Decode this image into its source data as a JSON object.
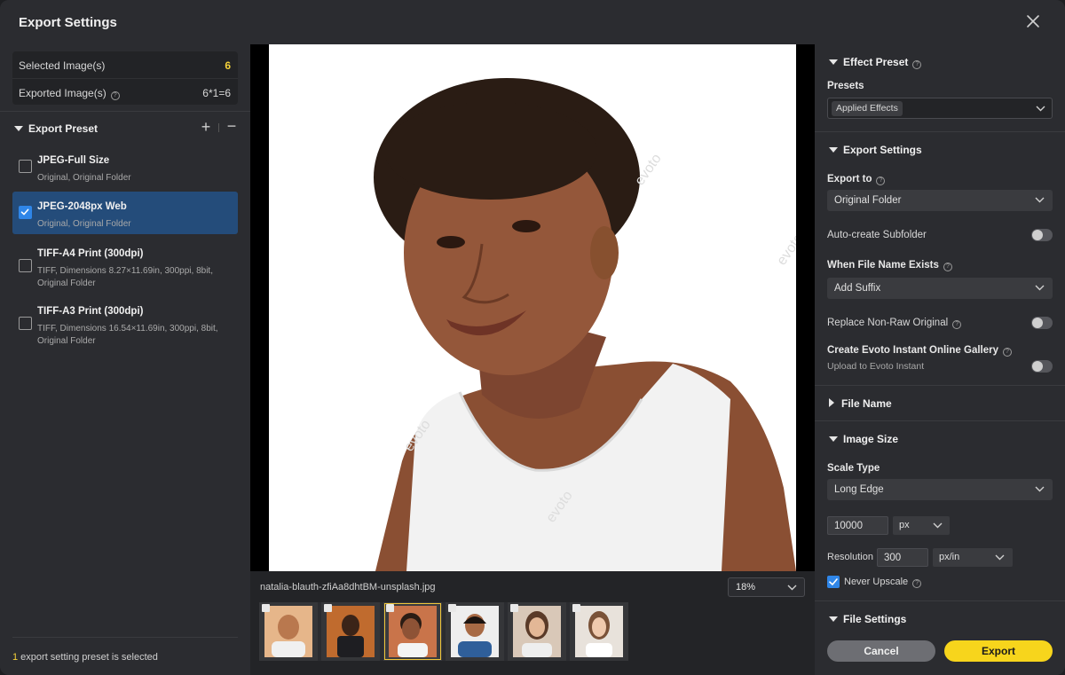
{
  "window": {
    "title": "Export Settings"
  },
  "summary": {
    "selected_label": "Selected Image(s)",
    "selected_value": "6",
    "exported_label": "Exported Image(s)",
    "exported_value": "6*1=6"
  },
  "export_preset": {
    "header": "Export Preset",
    "items": [
      {
        "name": "JPEG-Full Size",
        "desc": "Original, Original Folder",
        "selected": false
      },
      {
        "name": "JPEG-2048px Web",
        "desc": "Original, Original Folder",
        "selected": true
      },
      {
        "name": "TIFF-A4 Print (300dpi)",
        "desc": "TIFF, Dimensions 8.27×11.69in, 300ppi, 8bit, Original Folder",
        "selected": false
      },
      {
        "name": "TIFF-A3 Print (300dpi)",
        "desc": "TIFF, Dimensions 16.54×11.69in, 300ppi, 8bit, Original Folder",
        "selected": false
      }
    ],
    "footer_count": "1",
    "footer_text": " export setting preset is selected"
  },
  "preview": {
    "filename": "natalia-blauth-zfiAa8dhtBM-unsplash.jpg",
    "zoom": "18%",
    "thumbnails_count": 6,
    "selected_thumbnail": 3
  },
  "effect_preset": {
    "header": "Effect Preset",
    "presets_label": "Presets",
    "presets_value": "Applied Effects"
  },
  "export_settings": {
    "header": "Export Settings",
    "export_to_label": "Export to",
    "export_to_value": "Original Folder",
    "auto_subfolder_label": "Auto-create Subfolder",
    "auto_subfolder_on": false,
    "file_exists_label": "When File Name Exists",
    "file_exists_value": "Add Suffix",
    "replace_label": "Replace Non-Raw Original",
    "replace_on": false,
    "gallery_label": "Create Evoto Instant Online Gallery",
    "gallery_sub": "Upload to Evoto Instant",
    "gallery_on": false
  },
  "file_name": {
    "header": "File Name"
  },
  "image_size": {
    "header": "Image Size",
    "scale_type_label": "Scale Type",
    "scale_type_value": "Long Edge",
    "size_value": "10000",
    "size_unit": "px",
    "resolution_label": "Resolution",
    "resolution_value": "300",
    "resolution_unit": "px/in",
    "never_upscale_label": "Never Upscale",
    "never_upscale_checked": true
  },
  "file_settings": {
    "header": "File Settings"
  },
  "actions": {
    "cancel": "Cancel",
    "export": "Export"
  },
  "colors": {
    "accent_yellow": "#f7d51c",
    "selection_blue": "#244c7a",
    "checkbox_blue": "#2f86e8"
  }
}
